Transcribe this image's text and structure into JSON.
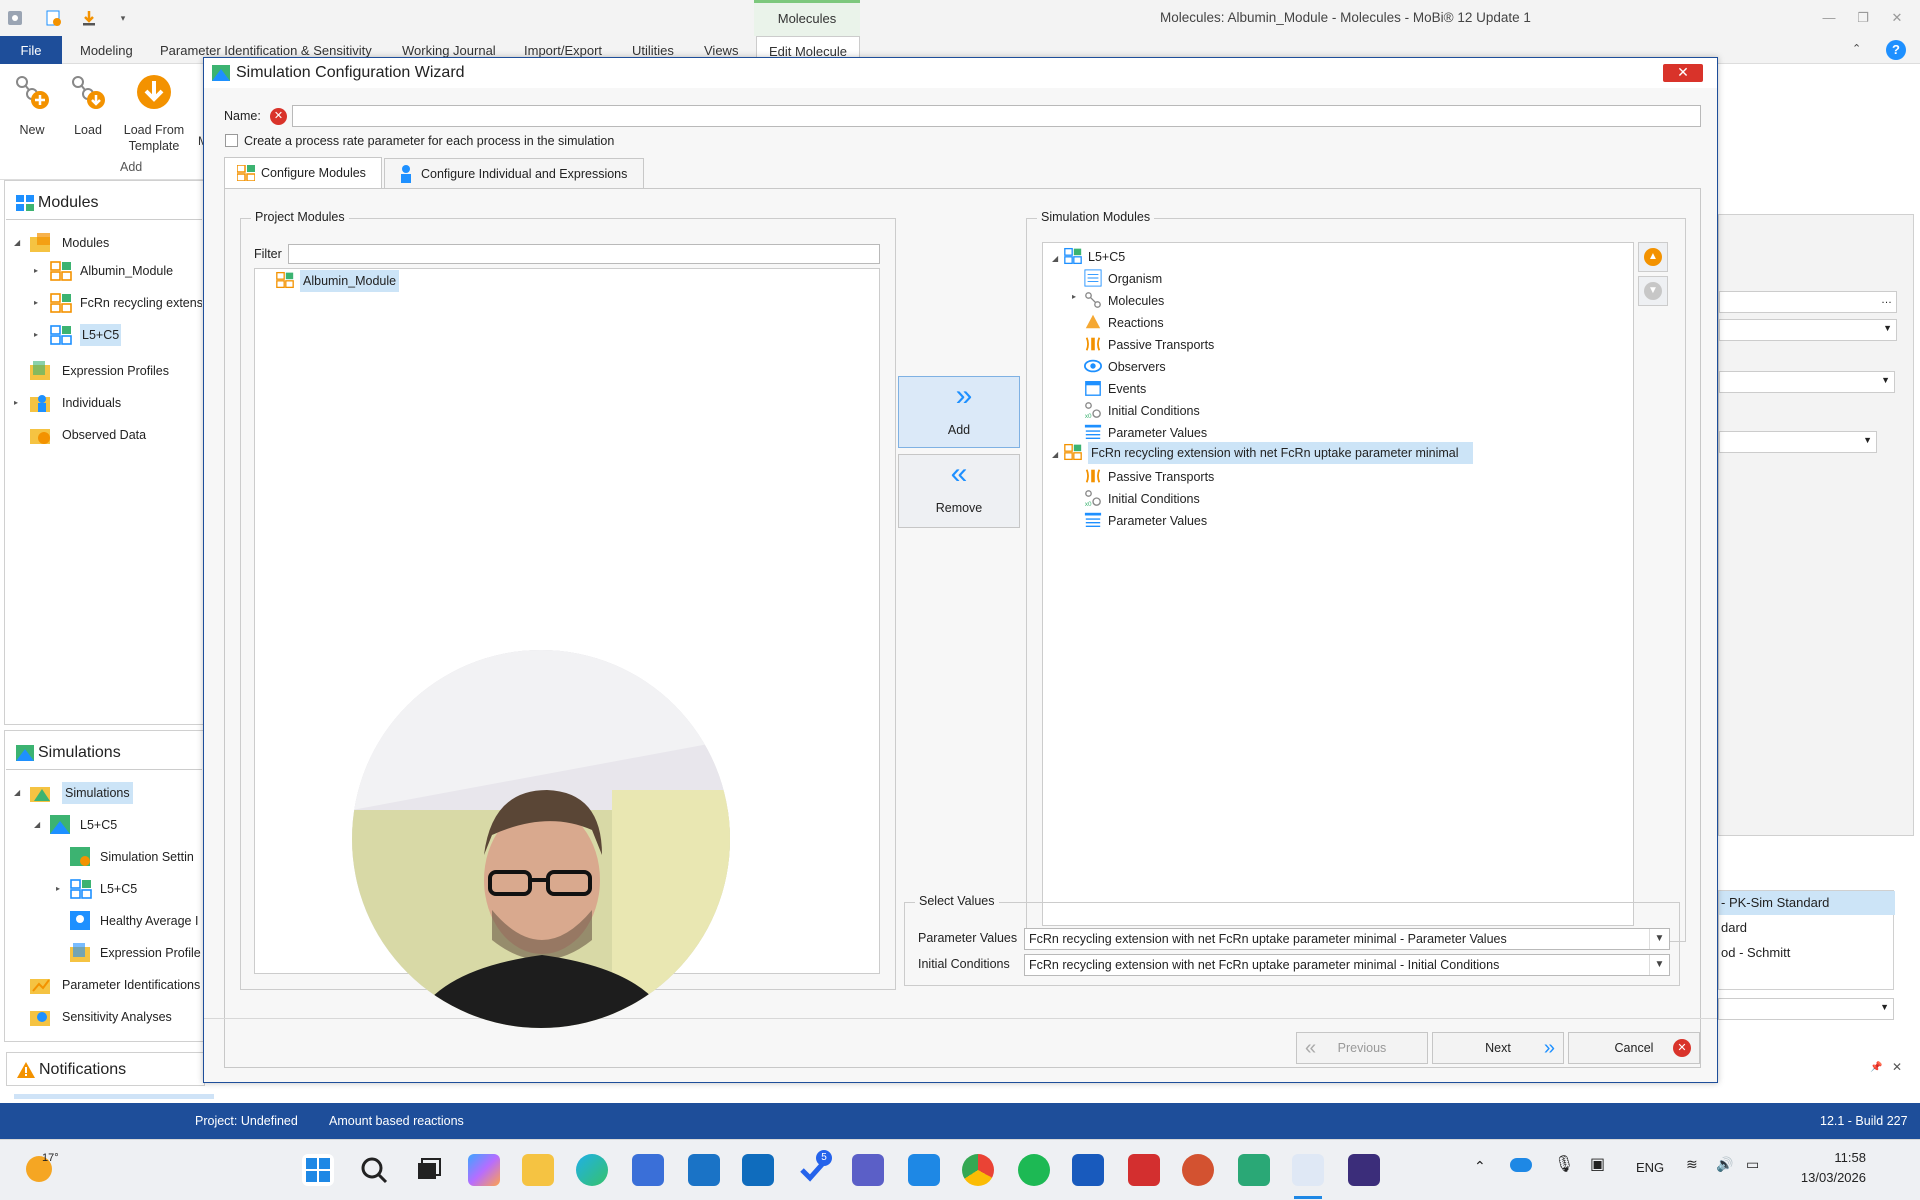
{
  "app": {
    "title": "Molecules: Albumin_Module - Molecules - MoBi® 12 Update 1",
    "context_tab": "Molecules"
  },
  "menu": {
    "file": "File",
    "items": [
      "Modeling",
      "Parameter Identification & Sensitivity",
      "Working Journal",
      "Import/Export",
      "Utilities",
      "Views",
      "Edit Molecule"
    ]
  },
  "ribbon": {
    "new": "New",
    "load": "Load",
    "load_from_template": "Load From Template",
    "group_label": "Add",
    "cut_label": "M"
  },
  "modules_panel": {
    "title": "Modules",
    "items": [
      {
        "label": "Modules"
      },
      {
        "label": "Albumin_Module"
      },
      {
        "label": "FcRn recycling extens"
      },
      {
        "label": "L5+C5"
      },
      {
        "label": "Expression Profiles"
      },
      {
        "label": "Individuals"
      },
      {
        "label": "Observed Data"
      }
    ]
  },
  "simulations_panel": {
    "title": "Simulations",
    "items": [
      {
        "label": "Simulations"
      },
      {
        "label": "L5+C5"
      },
      {
        "label": "Simulation Settin"
      },
      {
        "label": "L5+C5"
      },
      {
        "label": "Healthy Average I"
      },
      {
        "label": "Expression Profile"
      },
      {
        "label": "Parameter Identifications"
      },
      {
        "label": "Sensitivity Analyses"
      }
    ]
  },
  "notifications_panel": {
    "title": "Notifications"
  },
  "right_panel": {
    "rows": [
      "- PK-Sim Standard",
      "dard",
      "od - Schmitt"
    ]
  },
  "dialog": {
    "title": "Simulation Configuration Wizard",
    "name_label": "Name:",
    "name_value": "",
    "checkbox_label": "Create a process rate parameter for each process in the simulation",
    "tabs": [
      "Configure Modules",
      "Configure Individual and Expressions"
    ],
    "project_modules": {
      "title": "Project Modules",
      "filter_label": "Filter",
      "filter_value": "",
      "items": [
        "Albumin_Module"
      ]
    },
    "add_label": "Add",
    "remove_label": "Remove",
    "simulation_modules": {
      "title": "Simulation Modules",
      "tree": [
        {
          "label": "L5+C5",
          "level": 0
        },
        {
          "label": "Organism",
          "level": 1
        },
        {
          "label": "Molecules",
          "level": 1
        },
        {
          "label": "Reactions",
          "level": 1
        },
        {
          "label": "Passive Transports",
          "level": 1
        },
        {
          "label": "Observers",
          "level": 1
        },
        {
          "label": "Events",
          "level": 1
        },
        {
          "label": "Initial Conditions",
          "level": 1
        },
        {
          "label": "Parameter Values",
          "level": 1
        },
        {
          "label": "FcRn recycling extension with net FcRn uptake parameter minimal",
          "level": 0
        },
        {
          "label": "Passive Transports",
          "level": 1
        },
        {
          "label": "Initial Conditions",
          "level": 1
        },
        {
          "label": "Parameter Values",
          "level": 1
        }
      ]
    },
    "select_values": {
      "title": "Select Values",
      "parameter_values_label": "Parameter Values",
      "parameter_values_value": "FcRn recycling extension with net FcRn uptake parameter minimal - Parameter Values",
      "initial_conditions_label": "Initial Conditions",
      "initial_conditions_value": "FcRn recycling extension with net FcRn uptake parameter minimal - Initial Conditions"
    },
    "buttons": {
      "previous": "Previous",
      "next": "Next",
      "cancel": "Cancel"
    }
  },
  "status": {
    "project": "Project: Undefined",
    "reactions": "Amount based reactions",
    "build": "12.1 - Build 227"
  },
  "taskbar": {
    "weather": "17°",
    "language": "ENG",
    "time": "11:58",
    "date": "13/03/2026",
    "todo_badge": "5"
  },
  "colors": {
    "accent": "#1e4e9a",
    "orange": "#f39200",
    "close": "#d9332a",
    "selection": "#cce4f7"
  }
}
